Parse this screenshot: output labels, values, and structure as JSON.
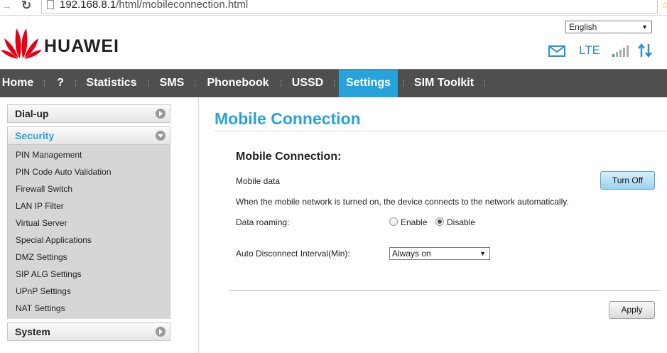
{
  "browser": {
    "url_host": "192.168.8.1",
    "url_path": "/html/mobileconnection.html"
  },
  "header": {
    "brand": "HUAWEI",
    "language": "English",
    "network_type": "LTE",
    "accent_color": "#27a3dc",
    "brand_color": "#e60012"
  },
  "nav": {
    "items": [
      {
        "label": "Home"
      },
      {
        "label": "?"
      },
      {
        "label": "Statistics"
      },
      {
        "label": "SMS"
      },
      {
        "label": "Phonebook"
      },
      {
        "label": "USSD"
      },
      {
        "label": "Settings"
      },
      {
        "label": "SIM Toolkit"
      }
    ],
    "active": "Settings"
  },
  "sidebar": {
    "dialup": "Dial-up",
    "security": "Security",
    "security_items": [
      "PIN Management",
      "PIN Code Auto Validation",
      "Firewall Switch",
      "LAN IP Filter",
      "Virtual Server",
      "Special Applications",
      "DMZ Settings",
      "SIP ALG Settings",
      "UPnP Settings",
      "NAT Settings"
    ],
    "system": "System"
  },
  "main": {
    "page_title": "Mobile Connection",
    "section_title": "Mobile Connection:",
    "mobile_data_label": "Mobile data",
    "turn_off_label": "Turn Off",
    "info_text": "When the mobile network is turned on, the device connects to the network automatically.",
    "roaming_label": "Data roaming:",
    "roaming_enable": "Enable",
    "roaming_disable": "Disable",
    "roaming_selected": "Disable",
    "auto_disconnect_label": "Auto Disconnect Interval(Min):",
    "auto_disconnect_value": "Always on",
    "apply_label": "Apply"
  }
}
